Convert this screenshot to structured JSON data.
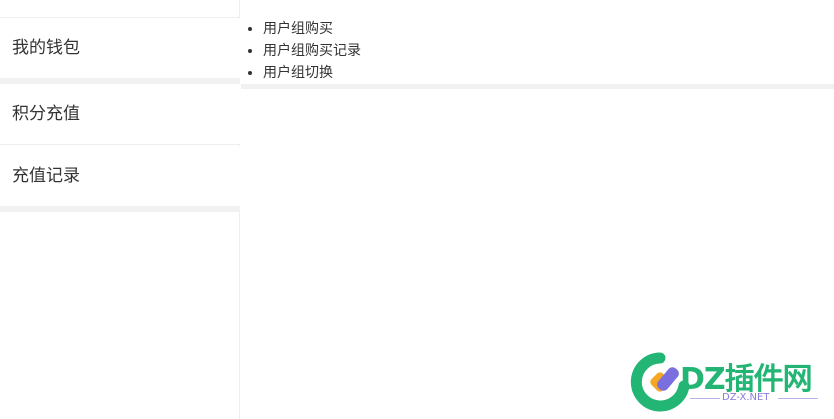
{
  "sidebar": {
    "items": [
      {
        "label": "我的钱包"
      },
      {
        "label": "积分充值"
      },
      {
        "label": "充值记录"
      }
    ]
  },
  "usergroup": {
    "links": [
      {
        "label": "用户组购买"
      },
      {
        "label": "用户组购买记录"
      },
      {
        "label": "用户组切换"
      }
    ]
  },
  "watermark": {
    "title": "DZ插件网",
    "subtitle": "DZ-X.NET"
  },
  "colors": {
    "brand_green": "#22b573",
    "brand_purple": "#8b7bd6",
    "separator": "#f1f1f1",
    "text": "#333333"
  }
}
